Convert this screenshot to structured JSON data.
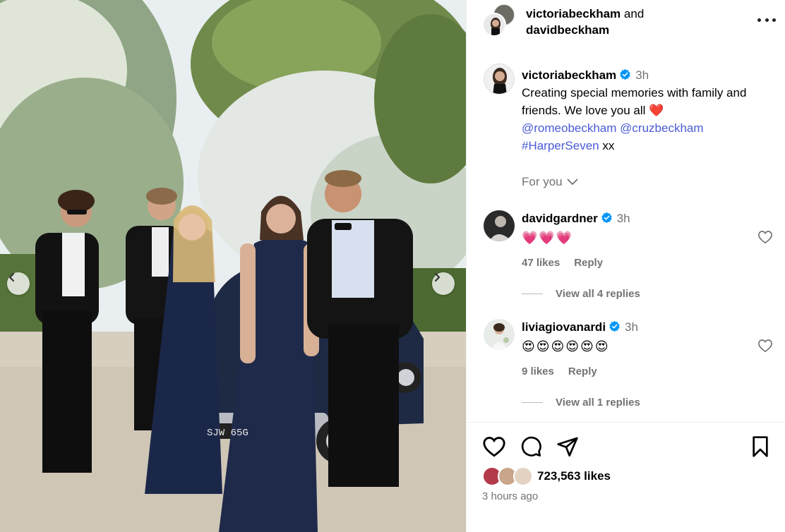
{
  "photo": {
    "plate": "SJW 65G",
    "nav_left_icon": "chevron-left-icon",
    "nav_right_icon": "chevron-right-icon"
  },
  "header": {
    "user1": "victoriabeckham",
    "connector": "and",
    "user2": "davidbeckham",
    "more_icon": "more-horizontal-icon"
  },
  "caption": {
    "username": "victoriabeckham",
    "time": "3h",
    "text_line": "Creating special memories with family and friends. We love you all",
    "emoji": "❤️",
    "mention1": "@romeobeckham",
    "mention2": "@cruzbeckham",
    "hashtag": "#HarperSeven",
    "suffix": "xx"
  },
  "for_you": "For you",
  "comments": [
    {
      "username": "davidgardner",
      "time": "3h",
      "text": "💗💗💗",
      "likes": "47 likes",
      "reply": "Reply",
      "view_replies": "View all 4 replies"
    },
    {
      "username": "liviagiovanardi",
      "time": "3h",
      "text": "😍😍😍😍😍😍",
      "likes": "9 likes",
      "reply": "Reply",
      "view_replies": "View all 1 replies"
    }
  ],
  "actions": {
    "like_icon": "heart-icon",
    "comment_icon": "comment-icon",
    "share_icon": "share-icon",
    "save_icon": "bookmark-icon",
    "likes": "723,563 likes",
    "time_ago": "3 hours ago"
  },
  "colors": {
    "verified": "#0095f6",
    "link": "#4a5bd8",
    "muted": "#737373",
    "dress": "#1f2a4a"
  }
}
